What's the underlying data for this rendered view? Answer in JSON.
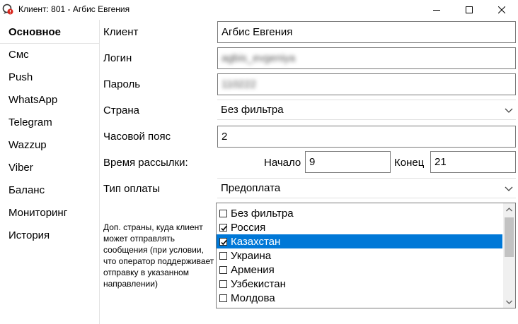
{
  "window": {
    "title": "Клиент: 801 - Агбис Евгения",
    "icon": "app-alert-icon",
    "controls": [
      "minimize-icon",
      "maximize-icon",
      "close-icon"
    ]
  },
  "sidebar": {
    "items": [
      {
        "label": "Основное",
        "active": true
      },
      {
        "label": "Смс"
      },
      {
        "label": "Push"
      },
      {
        "label": "WhatsApp"
      },
      {
        "label": "Telegram"
      },
      {
        "label": "Wazzup"
      },
      {
        "label": "Viber"
      },
      {
        "label": "Баланс"
      },
      {
        "label": "Мониторинг"
      },
      {
        "label": "История"
      }
    ]
  },
  "form": {
    "client": {
      "label": "Клиент",
      "value": "Агбис Евгения"
    },
    "login": {
      "label": "Логин",
      "value": "agbis_evgeniya"
    },
    "password": {
      "label": "Пароль",
      "value": "110222"
    },
    "country": {
      "label": "Страна",
      "value": "Без фильтра"
    },
    "timezone": {
      "label": "Часовой пояс",
      "value": "2"
    },
    "send_time": {
      "label": "Время рассылки:",
      "start_label": "Начало",
      "start_value": "9",
      "end_label": "Конец",
      "end_value": "21"
    },
    "payment": {
      "label": "Тип оплаты",
      "value": "Предоплата"
    },
    "extra_countries": {
      "note": "Доп. страны, куда клиент может отправлять сообщения (при условии, что оператор поддерживает отправку в указанном направлении)",
      "items": [
        {
          "label": "Без фильтра",
          "checked": false,
          "selected": false
        },
        {
          "label": "Россия",
          "checked": true,
          "selected": false
        },
        {
          "label": "Казахстан",
          "checked": true,
          "selected": true
        },
        {
          "label": "Украина",
          "checked": false,
          "selected": false
        },
        {
          "label": "Армения",
          "checked": false,
          "selected": false
        },
        {
          "label": "Узбекистан",
          "checked": false,
          "selected": false
        },
        {
          "label": "Молдова",
          "checked": false,
          "selected": false
        }
      ]
    }
  },
  "colors": {
    "selection": "#0078d7",
    "border": "#7a7a7a",
    "sidebar_divider": "#e3e3e3"
  }
}
